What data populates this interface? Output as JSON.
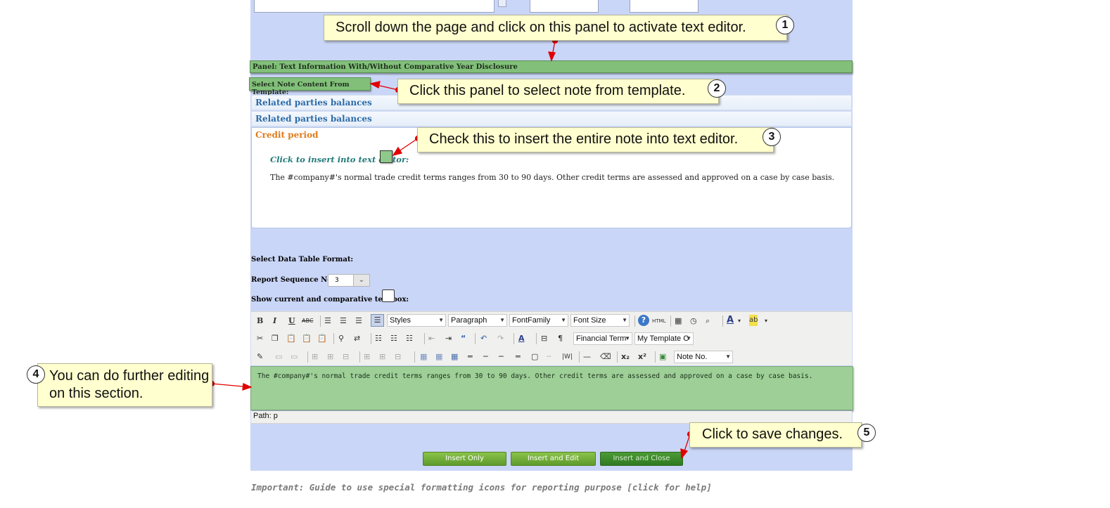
{
  "panel": {
    "title": "Panel: Text Information With/Without Comparative Year Disclosure"
  },
  "template_selector": {
    "label": "Select Note Content From Template:",
    "items": [
      "Related parties balances",
      "Related parties balances",
      "Credit period"
    ]
  },
  "note": {
    "insert_label": "Click to insert into text editor:",
    "text": "The #company#'s normal trade credit terms ranges from 30 to 90 days. Other credit terms are assessed and approved on a case by case basis."
  },
  "form": {
    "table_format_label": "Select Data Table Format:",
    "sequence_label": "Report Sequence No.:",
    "sequence_value": "3",
    "show_comparative_label": "Show current and comparative text box:"
  },
  "toolbar": {
    "styles": "Styles",
    "format": "Paragraph",
    "font_family": "FontFamily",
    "font_size": "Font Size",
    "financial_term": "Financial Term",
    "my_template": "My Template C",
    "note_no": "Note No."
  },
  "editor": {
    "content": "The #company#'s normal trade credit terms ranges from 30 to 90 days. Other credit terms are assessed and approved on a case by case basis.",
    "path": "Path: p"
  },
  "buttons": {
    "insert_only": "Insert Only",
    "insert_and_edit": "Insert and Edit",
    "insert_and_close": "Insert and Close"
  },
  "help_link": "Important: Guide to use special formatting icons for reporting purpose [click for help]",
  "callouts": [
    {
      "number": "1",
      "text": "Scroll down the page and click on this panel to activate text editor."
    },
    {
      "number": "2",
      "text": "Click this panel to select note from template."
    },
    {
      "number": "3",
      "text": "Check this to insert the entire note into text editor."
    },
    {
      "number": "4",
      "text": "You can do further editing on this section."
    },
    {
      "number": "5",
      "text": "Click to save changes."
    }
  ],
  "colors": {
    "panel_green": "#82c07a",
    "editor_green": "#9dcf97",
    "page_blue": "#cad6f7",
    "callout_yellow": "#ffffcf",
    "accent_orange": "#e07b1a"
  }
}
